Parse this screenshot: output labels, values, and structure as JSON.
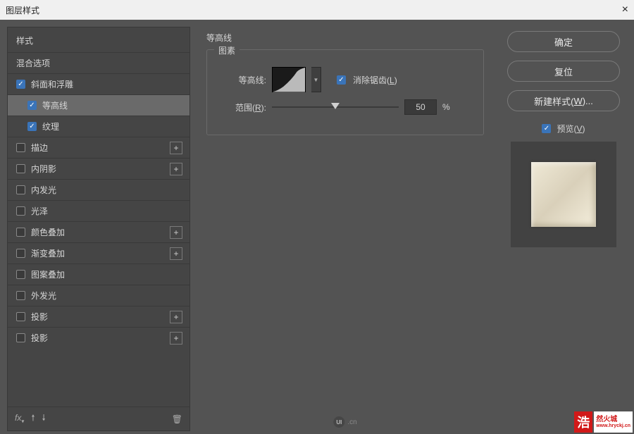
{
  "title": "图层样式",
  "left": {
    "styles": "样式",
    "blend": "混合选项",
    "items": [
      {
        "label": "斜面和浮雕",
        "checked": true,
        "add": false,
        "indent": 0
      },
      {
        "label": "等高线",
        "checked": true,
        "add": false,
        "indent": 1,
        "selected": true
      },
      {
        "label": "纹理",
        "checked": true,
        "add": false,
        "indent": 1
      },
      {
        "label": "描边",
        "checked": false,
        "add": true,
        "indent": 0
      },
      {
        "label": "内阴影",
        "checked": false,
        "add": true,
        "indent": 0
      },
      {
        "label": "内发光",
        "checked": false,
        "add": false,
        "indent": 0
      },
      {
        "label": "光泽",
        "checked": false,
        "add": false,
        "indent": 0
      },
      {
        "label": "颜色叠加",
        "checked": false,
        "add": true,
        "indent": 0
      },
      {
        "label": "渐变叠加",
        "checked": false,
        "add": true,
        "indent": 0
      },
      {
        "label": "图案叠加",
        "checked": false,
        "add": false,
        "indent": 0
      },
      {
        "label": "外发光",
        "checked": false,
        "add": false,
        "indent": 0
      },
      {
        "label": "投影",
        "checked": false,
        "add": true,
        "indent": 0
      },
      {
        "label": "投影",
        "checked": false,
        "add": true,
        "indent": 0
      }
    ],
    "fx": "fx"
  },
  "center": {
    "title": "等高线",
    "legend": "图素",
    "contour_label": "等高线:",
    "antialias": "消除锯齿(",
    "antialias_key": "L",
    "close_paren": ")",
    "range_label_pre": "范围(",
    "range_key": "R",
    "range_label_post": "):",
    "range_value": "50",
    "percent": "%",
    "logo": ".cn"
  },
  "right": {
    "ok": "确定",
    "reset": "复位",
    "new_style_pre": "新建样式(",
    "new_style_key": "W",
    "new_style_post": ")...",
    "preview_pre": "预览(",
    "preview_key": "V",
    "preview_post": ")"
  },
  "watermark": {
    "a": "浩",
    "b1": "然火城",
    "b2": "www.hryckj.cn"
  }
}
